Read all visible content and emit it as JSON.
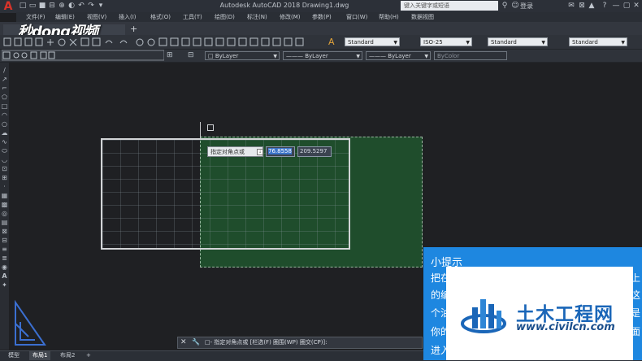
{
  "titlebar": {
    "app_letter": "A",
    "title": "Autodesk AutoCAD 2018    Drawing1.dwg",
    "search_placeholder": "键入关键字或短语",
    "login": "登录",
    "quick_icons": [
      "□",
      "▭",
      "■",
      "⊟",
      "⊕",
      "◐",
      "↶",
      "↷",
      "▾"
    ],
    "right_icons": [
      "⚲",
      "☺",
      "✉",
      "⊠",
      "▲",
      "?",
      "—",
      "▢",
      "✕"
    ]
  },
  "menu": {
    "items": [
      "文件(F)",
      "编辑(E)",
      "视图(V)",
      "插入(I)",
      "格式(O)",
      "工具(T)",
      "绘图(D)",
      "标注(N)",
      "修改(M)",
      "参数(P)",
      "窗口(W)",
      "帮助(H)",
      "数据视图"
    ]
  },
  "watermark": {
    "brand": "秒dong视频"
  },
  "doc_tab": {
    "plus": "+"
  },
  "toolbar": {
    "text_style": "Standard",
    "dim_style": "ISO-25",
    "table_style": "Standard",
    "mleader_style": "Standard",
    "layer": "ByLayer",
    "linetype": "ByLayer",
    "lineweight": "ByLayer",
    "color": "ByColor"
  },
  "canvas": {
    "prompt_label": "指定对角点或",
    "coord_x": "76.8558",
    "coord_y": "209.5297"
  },
  "command_line": {
    "text": "□-  指定对角点或 [栏选(F) 圈围(WP) 圈交(CP)]:"
  },
  "layout_tabs": [
    "模型",
    "布局1",
    "布局2",
    "+"
  ],
  "tip": {
    "title": "小提示",
    "lines_left": [
      "把在",
      "的编",
      "个油",
      "你的",
      "进入"
    ],
    "lines_right": [
      "上",
      "这",
      "是",
      "面"
    ]
  },
  "site_logo": {
    "name": "土木工程网",
    "url": "www.civilcn.com"
  },
  "colors": {
    "background": "#1f2023",
    "selection_window": "#1f4d2c",
    "tip_panel": "#1e87e0",
    "logo_blue": "#1a66b8"
  }
}
